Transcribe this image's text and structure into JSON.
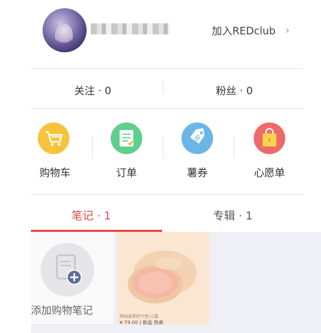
{
  "profile": {
    "redclub_link": "加入REDclub",
    "chevron": "›"
  },
  "stats": {
    "following": "关注 · 0",
    "fans": "粉丝 · 0"
  },
  "shortcuts": [
    {
      "label": "购物车",
      "icon": "shopping-cart-icon",
      "color": "#f5c43c"
    },
    {
      "label": "订单",
      "icon": "order-list-icon",
      "color": "#5fcf8e"
    },
    {
      "label": "薯券",
      "icon": "coupon-tag-icon",
      "color": "#6cb6e6"
    },
    {
      "label": "心愿单",
      "icon": "wishlist-bag-icon",
      "color": "#ee6a6a"
    }
  ],
  "tabs": {
    "notes": "笔记 · 1",
    "albums": "专辑 · 1"
  },
  "notes": {
    "add_label": "添加购物笔记",
    "card_caption": "韩国爱茉莉气垫CC霜",
    "card_price": "¥ 79.00 | 新品 热卖"
  },
  "colors": {
    "accent": "#e54848",
    "content_bg": "#eef0f5"
  }
}
